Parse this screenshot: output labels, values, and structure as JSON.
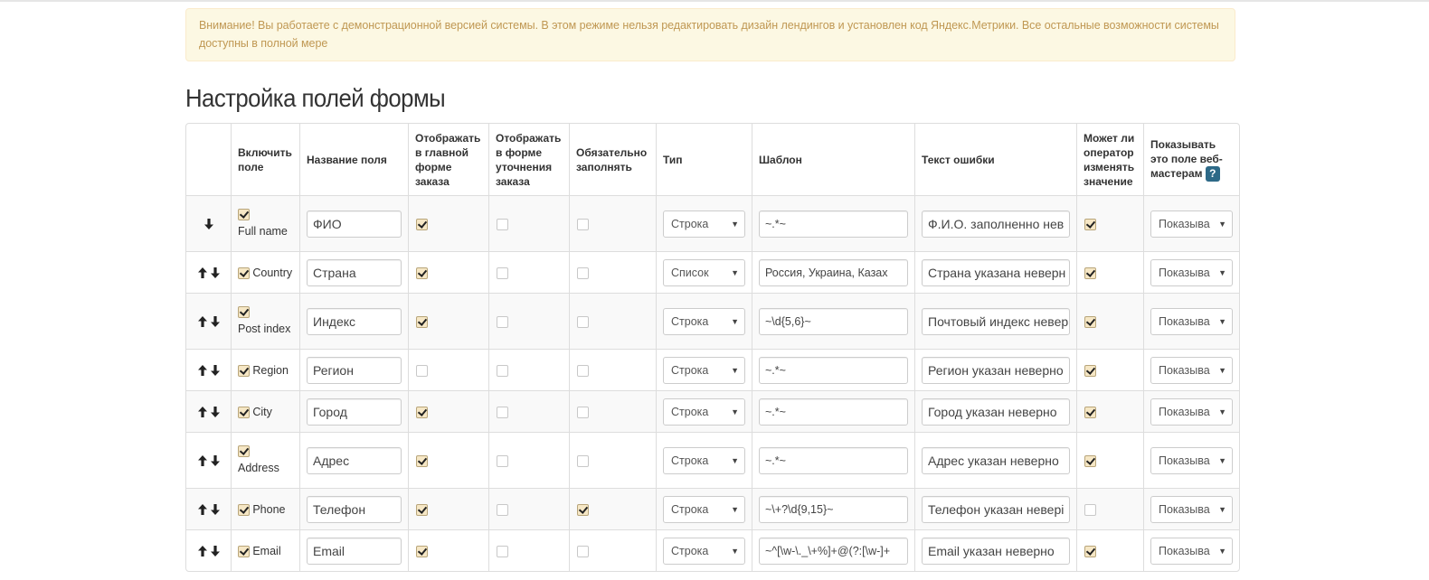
{
  "notice": {
    "text": "Внимание! Вы работаете с демонстрационной версией системы. В этом режиме нельзя редактировать дизайн лендингов и установлен код Яндекс.Метрики. Все остальные возможности системы доступны в полной мере"
  },
  "page_title": "Настройка полей формы",
  "table": {
    "headers": {
      "enable": "Включить поле",
      "name": "Название поля",
      "main_form": "Отображать в главной форме заказа",
      "clarify_form": "Отображать в форме уточнения заказа",
      "required": "Обязательно заполнять",
      "type": "Тип",
      "template": "Шаблон",
      "error_text": "Текст ошибки",
      "operator_edit": "Может ли оператор изменять значение",
      "webmaster_show": "Показывать это поле веб-мастерам",
      "help_icon": "?"
    },
    "rows": [
      {
        "key": "Full name",
        "enabled": true,
        "name": "ФИО",
        "main_form": true,
        "clarify_form": false,
        "required": false,
        "type": "Строка",
        "template": "~.*~",
        "error_text": "Ф.И.О. заполненно нев",
        "operator_edit": true,
        "webmaster_show": "Показыва",
        "can_move_up": false,
        "can_move_down": true
      },
      {
        "key": "Country",
        "enabled": true,
        "name": "Страна",
        "main_form": true,
        "clarify_form": false,
        "required": false,
        "type": "Список",
        "template": "Россия, Украина, Казах",
        "error_text": "Страна указана неверн",
        "operator_edit": true,
        "webmaster_show": "Показыва",
        "can_move_up": true,
        "can_move_down": true
      },
      {
        "key": "Post index",
        "enabled": true,
        "name": "Индекс",
        "main_form": true,
        "clarify_form": false,
        "required": false,
        "type": "Строка",
        "template": "~\\d{5,6}~",
        "error_text": "Почтовый индекс невер",
        "operator_edit": true,
        "webmaster_show": "Показыва",
        "can_move_up": true,
        "can_move_down": true
      },
      {
        "key": "Region",
        "enabled": true,
        "name": "Регион",
        "main_form": false,
        "clarify_form": false,
        "required": false,
        "type": "Строка",
        "template": "~.*~",
        "error_text": "Регион указан неверно",
        "operator_edit": true,
        "webmaster_show": "Показыва",
        "can_move_up": true,
        "can_move_down": true
      },
      {
        "key": "City",
        "enabled": true,
        "name": "Город",
        "main_form": true,
        "clarify_form": false,
        "required": false,
        "type": "Строка",
        "template": "~.*~",
        "error_text": "Город указан неверно",
        "operator_edit": true,
        "webmaster_show": "Показыва",
        "can_move_up": true,
        "can_move_down": true
      },
      {
        "key": "Address",
        "enabled": true,
        "name": "Адрес",
        "main_form": true,
        "clarify_form": false,
        "required": false,
        "type": "Строка",
        "template": "~.*~",
        "error_text": "Адрес указан неверно",
        "operator_edit": true,
        "webmaster_show": "Показыва",
        "can_move_up": true,
        "can_move_down": true
      },
      {
        "key": "Phone",
        "enabled": true,
        "name": "Телефон",
        "main_form": true,
        "clarify_form": false,
        "required": true,
        "type": "Строка",
        "template": "~\\+?\\d{9,15}~",
        "error_text": "Телефон указан невері",
        "operator_edit": false,
        "webmaster_show": "Показыва",
        "can_move_up": true,
        "can_move_down": true
      },
      {
        "key": "Email",
        "enabled": true,
        "name": "Email",
        "main_form": true,
        "clarify_form": false,
        "required": false,
        "type": "Строка",
        "template": "~^[\\w-\\._\\+%]+@(?:[\\w-]+",
        "error_text": "Email указан неверно",
        "operator_edit": true,
        "webmaster_show": "Показыва",
        "can_move_up": true,
        "can_move_down": true
      }
    ]
  },
  "icons": {
    "arrow_up": "arrow-up-icon",
    "arrow_down": "arrow-down-icon",
    "select_caret": "▼"
  }
}
